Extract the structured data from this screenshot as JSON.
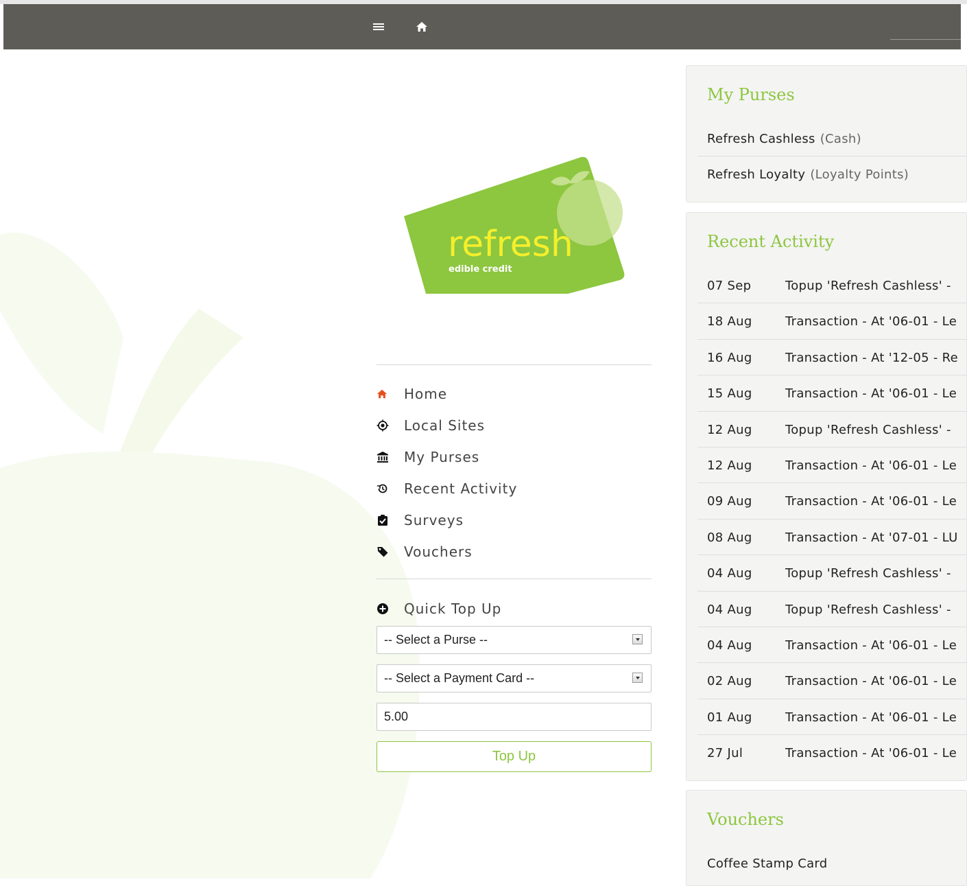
{
  "colors": {
    "brand_green": "#8dc63f",
    "navbar": "#5d5c57",
    "home_accent": "#e8501e"
  },
  "navbar": {
    "menu_icon": "hamburger-icon",
    "home_icon": "home-icon"
  },
  "logo": {
    "wordmark": "refresh",
    "tagline": "edible credit"
  },
  "menu": [
    {
      "label": "Home",
      "icon": "home-icon"
    },
    {
      "label": "Local Sites",
      "icon": "target-icon"
    },
    {
      "label": "My Purses",
      "icon": "bank-icon"
    },
    {
      "label": "Recent Activity",
      "icon": "history-icon"
    },
    {
      "label": "Surveys",
      "icon": "clipboard-check-icon"
    },
    {
      "label": "Vouchers",
      "icon": "tag-icon"
    }
  ],
  "quick_topup": {
    "title": "Quick Top Up",
    "icon": "plus-circle-icon",
    "purse_select": "-- Select a Purse --",
    "card_select": "-- Select a Payment Card --",
    "amount": "5.00",
    "button": "Top Up"
  },
  "purses": {
    "title": "My Purses",
    "items": [
      {
        "name": "Refresh Cashless",
        "type": "(Cash)"
      },
      {
        "name": "Refresh Loyalty",
        "type": "(Loyalty Points)"
      }
    ]
  },
  "activity": {
    "title": "Recent Activity",
    "items": [
      {
        "date": "07 Sep",
        "text": "Topup 'Refresh Cashless' -"
      },
      {
        "date": "18 Aug",
        "text": "Transaction - At '06-01 - Le"
      },
      {
        "date": "16 Aug",
        "text": "Transaction - At '12-05 - Re"
      },
      {
        "date": "15 Aug",
        "text": "Transaction - At '06-01 - Le"
      },
      {
        "date": "12 Aug",
        "text": "Topup 'Refresh Cashless' -"
      },
      {
        "date": "12 Aug",
        "text": "Transaction - At '06-01 - Le"
      },
      {
        "date": "09 Aug",
        "text": "Transaction - At '06-01 - Le"
      },
      {
        "date": "08 Aug",
        "text": "Transaction - At '07-01 - LU"
      },
      {
        "date": "04 Aug",
        "text": "Topup 'Refresh Cashless' -"
      },
      {
        "date": "04 Aug",
        "text": "Topup 'Refresh Cashless' -"
      },
      {
        "date": "04 Aug",
        "text": "Transaction - At '06-01 - Le"
      },
      {
        "date": "02 Aug",
        "text": "Transaction - At '06-01 - Le"
      },
      {
        "date": "01 Aug",
        "text": "Transaction - At '06-01 - Le"
      },
      {
        "date": "27 Jul",
        "text": "Transaction - At '06-01 - Le"
      }
    ]
  },
  "vouchers": {
    "title": "Vouchers",
    "items": [
      {
        "name": "Coffee Stamp Card"
      }
    ]
  }
}
